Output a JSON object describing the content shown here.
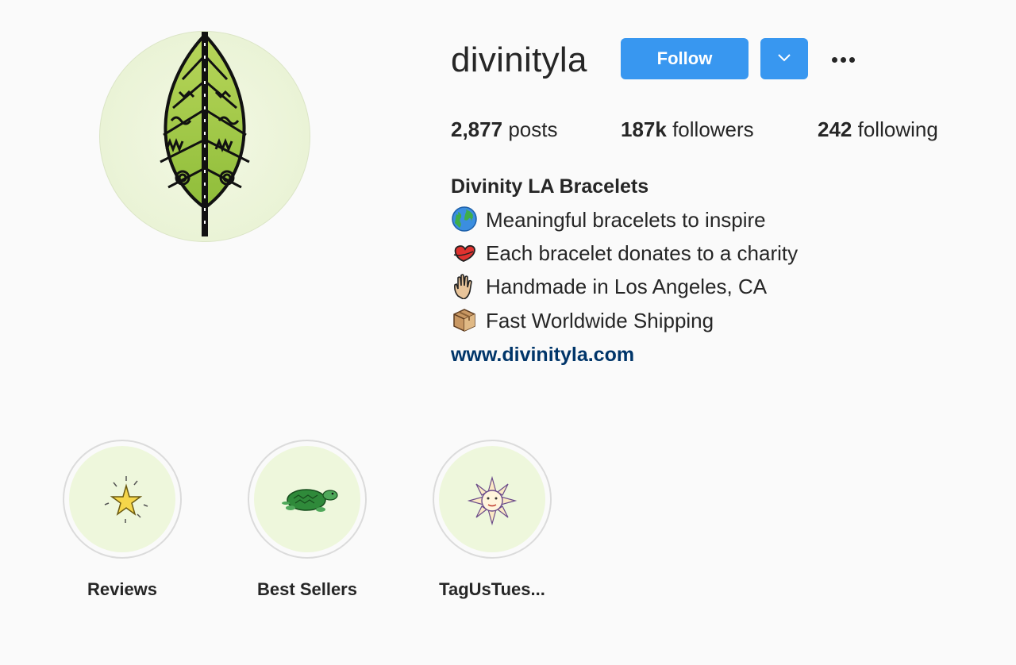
{
  "profile": {
    "username": "divinityla",
    "follow_label": "Follow",
    "stats": {
      "posts_count": "2,877",
      "posts_label": "posts",
      "followers_count": "187k",
      "followers_label": "followers",
      "following_count": "242",
      "following_label": "following"
    },
    "full_name": "Divinity LA Bracelets",
    "bio": [
      {
        "icon": "globe-emoji",
        "text": "Meaningful bracelets to inspire"
      },
      {
        "icon": "heart-emoji",
        "text": "Each bracelet donates to a charity"
      },
      {
        "icon": "raised-hand-emoji",
        "text": "Handmade in Los Angeles, CA"
      },
      {
        "icon": "package-emoji",
        "text": "Fast Worldwide Shipping"
      }
    ],
    "website": "www.divinityla.com"
  },
  "highlights": [
    {
      "label": "Reviews",
      "icon": "star-icon"
    },
    {
      "label": "Best Sellers",
      "icon": "turtle-icon"
    },
    {
      "label": "TagUsTues...",
      "icon": "sun-icon"
    }
  ],
  "colors": {
    "follow_button": "#3897f0",
    "website_link": "#003569",
    "background": "#fafafa",
    "highlight_fill": "#eef7dc"
  }
}
